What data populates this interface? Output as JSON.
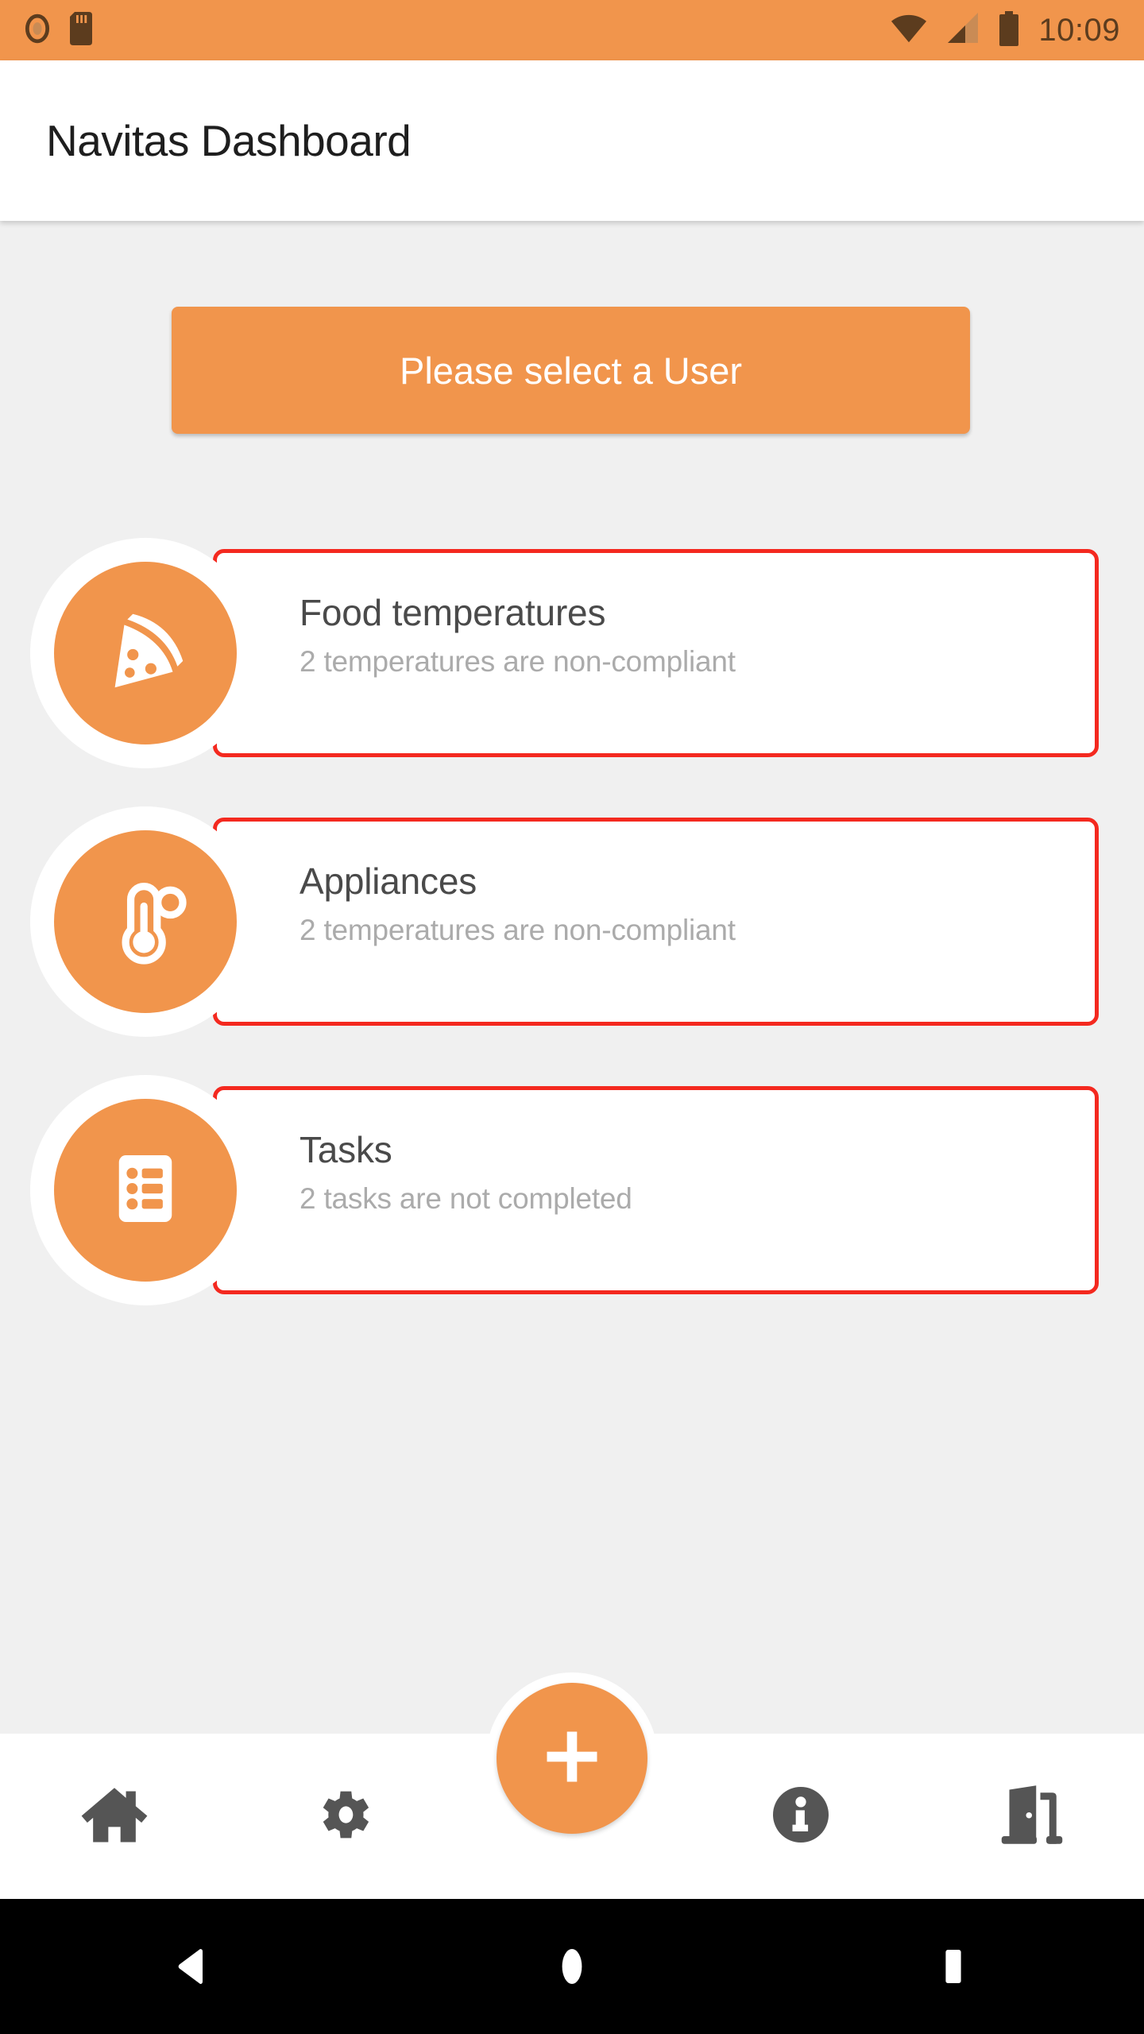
{
  "status_bar": {
    "time": "10:09",
    "icons_left": [
      "record-icon",
      "sd-card-icon"
    ],
    "icons_right": [
      "wifi-icon",
      "signal-icon",
      "battery-icon"
    ],
    "background_color": "#F1954C",
    "foreground_color": "#5C3C1E"
  },
  "toolbar": {
    "title": "Navitas Dashboard"
  },
  "user_select": {
    "label": "Please select a User",
    "color": "#F1954C"
  },
  "cards": [
    {
      "icon": "pizza-slice-icon",
      "title": "Food temperatures",
      "subtitle": "2 temperatures are non-compliant",
      "border_color": "#F4291F",
      "status": "non-compliant"
    },
    {
      "icon": "thermometer-icon",
      "title": "Appliances",
      "subtitle": "2 temperatures are non-compliant",
      "border_color": "#F4291F",
      "status": "non-compliant"
    },
    {
      "icon": "task-list-icon",
      "title": "Tasks",
      "subtitle": "2 tasks are not completed",
      "border_color": "#F4291F",
      "status": "not-completed"
    }
  ],
  "bottom_nav": {
    "items": [
      {
        "icon": "home-icon",
        "name": "home"
      },
      {
        "icon": "gear-icon",
        "name": "settings"
      },
      {
        "icon": "plus-icon",
        "name": "add"
      },
      {
        "icon": "info-icon",
        "name": "info"
      },
      {
        "icon": "exit-door-icon",
        "name": "logout"
      }
    ],
    "icon_color": "#555555",
    "fab_color": "#F1954C"
  },
  "android_nav": {
    "buttons": [
      "back-button",
      "home-button",
      "recents-button"
    ]
  },
  "theme": {
    "accent": "#F1954C",
    "alert": "#F4291F",
    "page_background": "#F0F0F0",
    "title_text": "#1E1E1E",
    "card_title_text": "#4A4A4A",
    "card_subtitle_text": "#ABABAB"
  }
}
